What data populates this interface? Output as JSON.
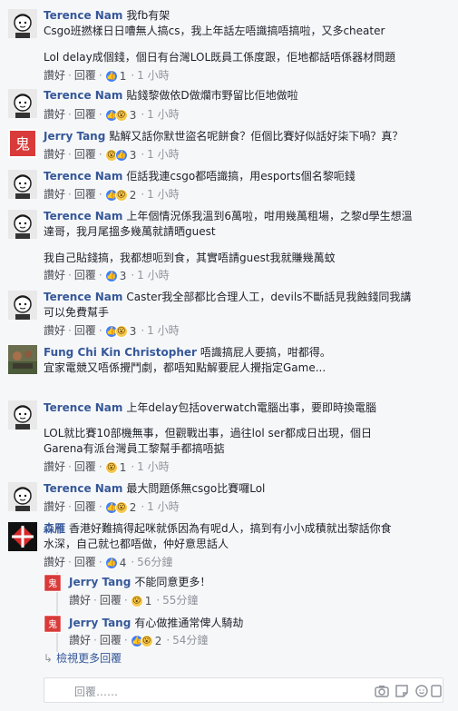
{
  "comments": [
    {
      "id": "c1",
      "author": "Terence Nam",
      "lines": [
        "我fb有架",
        "Csgo班撚樣日日嘈無人搞cs，我上年話左唔識搞唔搞啦，又多cheater",
        "Lol delay成個錢，個日有台灣LOL既員工係度跟，佢地都話唔係器材問題"
      ],
      "like": "讚好",
      "reply": "回覆",
      "count": "1",
      "time": "1 小時"
    },
    {
      "id": "c2",
      "author": "Terence Nam",
      "lines": [
        "貼錢黎做依D做爛市野留比佢地做啦"
      ],
      "like": "讚好",
      "reply": "回覆",
      "count": "3",
      "time": "1 小時"
    },
    {
      "id": "c3",
      "author": "Jerry Tang",
      "lines": [
        "點解又話你默世盜名呢餅食？佢個比賽好似話好柒下喎？真？"
      ],
      "like": "讚好",
      "reply": "回覆",
      "count": "3",
      "time": "1 小時"
    },
    {
      "id": "c4",
      "author": "Terence Nam",
      "lines": [
        "佢話我連csgo都唔識搞，用esports個名黎呃錢"
      ],
      "like": "讚好",
      "reply": "回覆",
      "count": "2",
      "time": "1 小時"
    },
    {
      "id": "c5",
      "author": "Terence Nam",
      "lines": [
        "上年個情況係我溫到6萬啦，咁用幾萬租場，之黎d學生想溫",
        "達哥，我月尾搵多幾萬就請晒guest",
        "我自己貼錢搞，我都想呃到食，其實唔請guest我就賺幾萬蚊"
      ],
      "like": "讚好",
      "reply": "回覆",
      "count": "3",
      "time": "1 小時"
    },
    {
      "id": "c6",
      "author": "Terence Nam",
      "lines": [
        "Caster我全部都比合理人工，devils不斷話見我蝕錢同我講",
        "可以免費幫手"
      ],
      "like": "讚好",
      "reply": "回覆",
      "count": "3",
      "time": "1 小時"
    },
    {
      "id": "c7",
      "author": "Fung Chi Kin Christopher",
      "lines": [
        "唔識搞屁人要搞，咁都得。",
        "宜家電競又唔係攪鬥劇，都唔知點解要屁人攪指定Game..."
      ],
      "like": "",
      "reply": "",
      "count": "",
      "time": ""
    },
    {
      "id": "c8",
      "author": "Terence Nam",
      "lines": [
        "上年delay包括overwatch電腦出事，要即時換電腦",
        "LOL就比賽10部機無事，但觀戰出事，過往lol ser都成日出現，個日",
        "Garena有派台灣員工黎幫手都搞唔掂"
      ],
      "like": "讚好",
      "reply": "回覆",
      "count": "1",
      "time": "1 小時"
    },
    {
      "id": "c9",
      "author": "Terence Nam",
      "lines": [
        "最大問題係無csgo比賽囉Lol"
      ],
      "like": "讚好",
      "reply": "回覆",
      "count": "2",
      "time": "1 小時"
    },
    {
      "id": "c10",
      "author": "森雁",
      "lines": [
        "香港好難搞得起咪就係因為有呢d人，搞到有小小成積就出黎話你食",
        "水深，自己就乜都唔做，仲好意思話人"
      ],
      "like": "讚好",
      "reply": "回覆",
      "count": "4",
      "time": "56分鐘"
    },
    {
      "id": "r1",
      "author": "Jerry Tang",
      "lines": [
        "不能同意更多！"
      ],
      "like": "讚好",
      "reply": "回覆",
      "count": "1",
      "time": "55分鐘"
    },
    {
      "id": "r2",
      "author": "Jerry Tang",
      "lines": [
        "有心做推通常俾人騎劫"
      ],
      "like": "讚好",
      "reply": "回覆",
      "count": "2",
      "time": "54分鐘"
    }
  ],
  "view_more_replies": "檢視更多回覆",
  "composer": {
    "placeholder": "回覆……"
  },
  "icons": [
    "camera-icon",
    "sticker-icon",
    "emoji-icon",
    "gif-icon"
  ],
  "colors": {
    "link": "#365899",
    "like_blue": "#4080ff",
    "wow_yellow": "#f7c74a"
  }
}
